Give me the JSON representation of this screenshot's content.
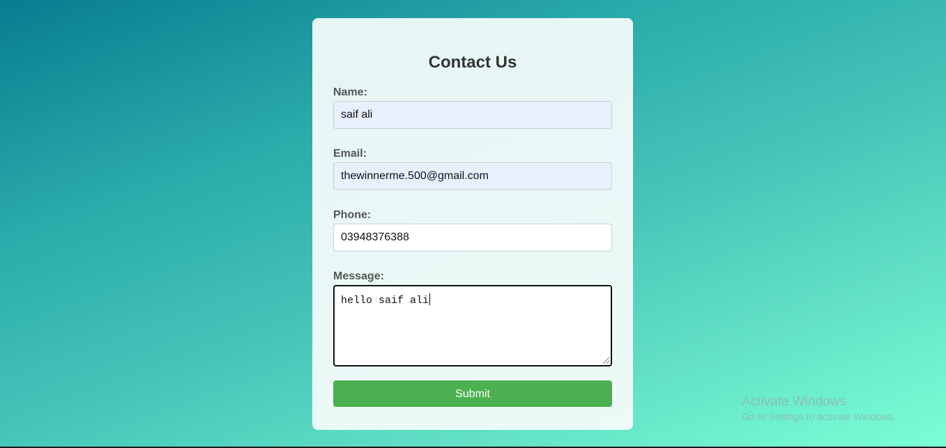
{
  "form": {
    "title": "Contact Us",
    "name": {
      "label": "Name:",
      "value": "saif ali"
    },
    "email": {
      "label": "Email:",
      "value": "thewinnerme.500@gmail.com"
    },
    "phone": {
      "label": "Phone:",
      "value": "03948376388"
    },
    "message": {
      "label": "Message:",
      "value": "hello saif ali"
    },
    "submit_label": "Submit"
  },
  "watermark": {
    "title": "Activate Windows",
    "subtitle": "Go to Settings to activate Windows."
  },
  "colors": {
    "submit_button": "#4caf50",
    "autofill_field": "#e8f0fe",
    "heading_text": "#333333",
    "label_text": "#555555"
  }
}
